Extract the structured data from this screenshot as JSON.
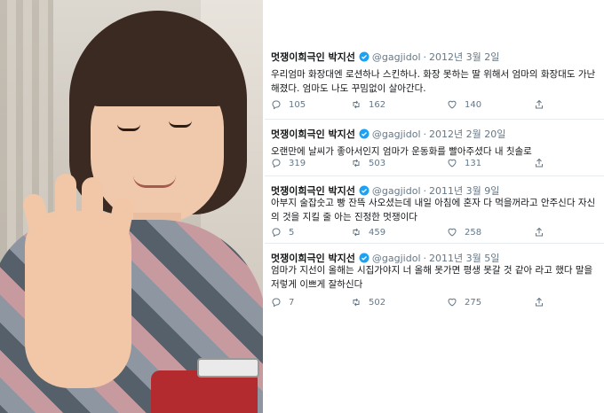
{
  "tweets": [
    {
      "name": "멋쟁이희극인 박지선",
      "handle": "@gagjidol",
      "date": "2012년 3월 2일",
      "text": "우리엄마 화장대엔 로션하나 스킨하나. 화장 못하는 딸 위해서 엄마의 화장대도 가난해졌다. 엄마도 나도 꾸밈없이 살아간다.",
      "replies": "105",
      "retweets": "162",
      "likes": "140"
    },
    {
      "name": "멋쟁이희극인 박지선",
      "handle": "@gagjidol",
      "date": "2012년 2월 20일",
      "text": "오랜만에 날씨가 좋아서인지 엄마가 운동화를 빨아주셨다 내 칫솔로",
      "replies": "319",
      "retweets": "503",
      "likes": "131"
    },
    {
      "name": "멋쟁이희극인 박지선",
      "handle": "@gagjidol",
      "date": "2011년 3월 9일",
      "text": "아부지 술잡숫고 빵 잔뜩 사오셨는데 내일 아침에 혼자 다 먹을꺼라고 안주신다 자신의 것을 지킬 줄 아는 진정한 멋쟁이다",
      "replies": "5",
      "retweets": "459",
      "likes": "258"
    },
    {
      "name": "멋쟁이희극인 박지선",
      "handle": "@gagjidol",
      "date": "2011년 3월 5일",
      "text": "엄마가 지선이 올해는 시집가야지 너 올해 못가면 평생 못갈 것 같아 라고 했다 말을 저렇게 이쁘게 잘하신다",
      "replies": "7",
      "retweets": "502",
      "likes": "275"
    }
  ],
  "separator": "·",
  "colors": {
    "verified": "#1da1f2",
    "text": "#14171a",
    "muted": "#657786"
  },
  "icons": [
    "verified-badge-icon",
    "reply-icon",
    "retweet-icon",
    "like-icon",
    "share-icon"
  ]
}
